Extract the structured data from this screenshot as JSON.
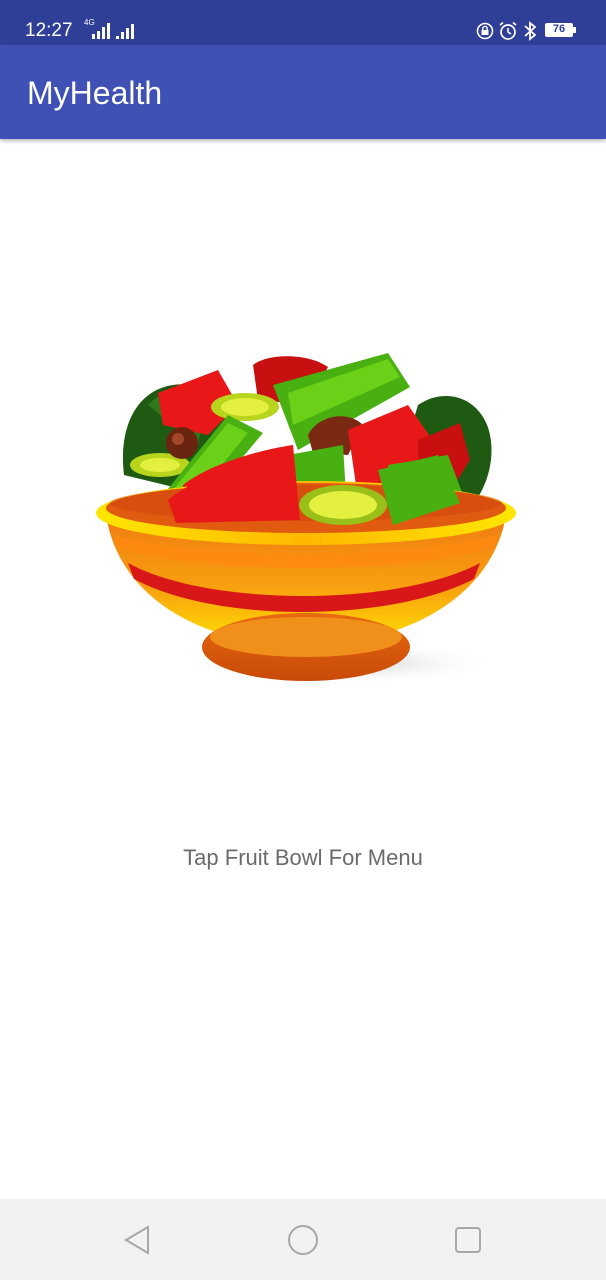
{
  "status_bar": {
    "time": "12:27",
    "network_label": "4G",
    "battery_level": "76",
    "icons": [
      "signal-4g-icon",
      "signal-icon",
      "lock-icon",
      "alarm-icon",
      "bluetooth-icon",
      "battery-icon"
    ]
  },
  "app_bar": {
    "title": "MyHealth"
  },
  "main": {
    "image_name": "fruit-bowl-icon",
    "hint_text": "Tap Fruit Bowl For Menu"
  },
  "nav_bar": {
    "icons": [
      "back-icon",
      "home-icon",
      "recents-icon"
    ]
  },
  "colors": {
    "status_bar": "#2f3f98",
    "app_bar": "#3f51b5",
    "hint_text": "#6b6b6b",
    "nav_bar": "#f2f2f2"
  }
}
